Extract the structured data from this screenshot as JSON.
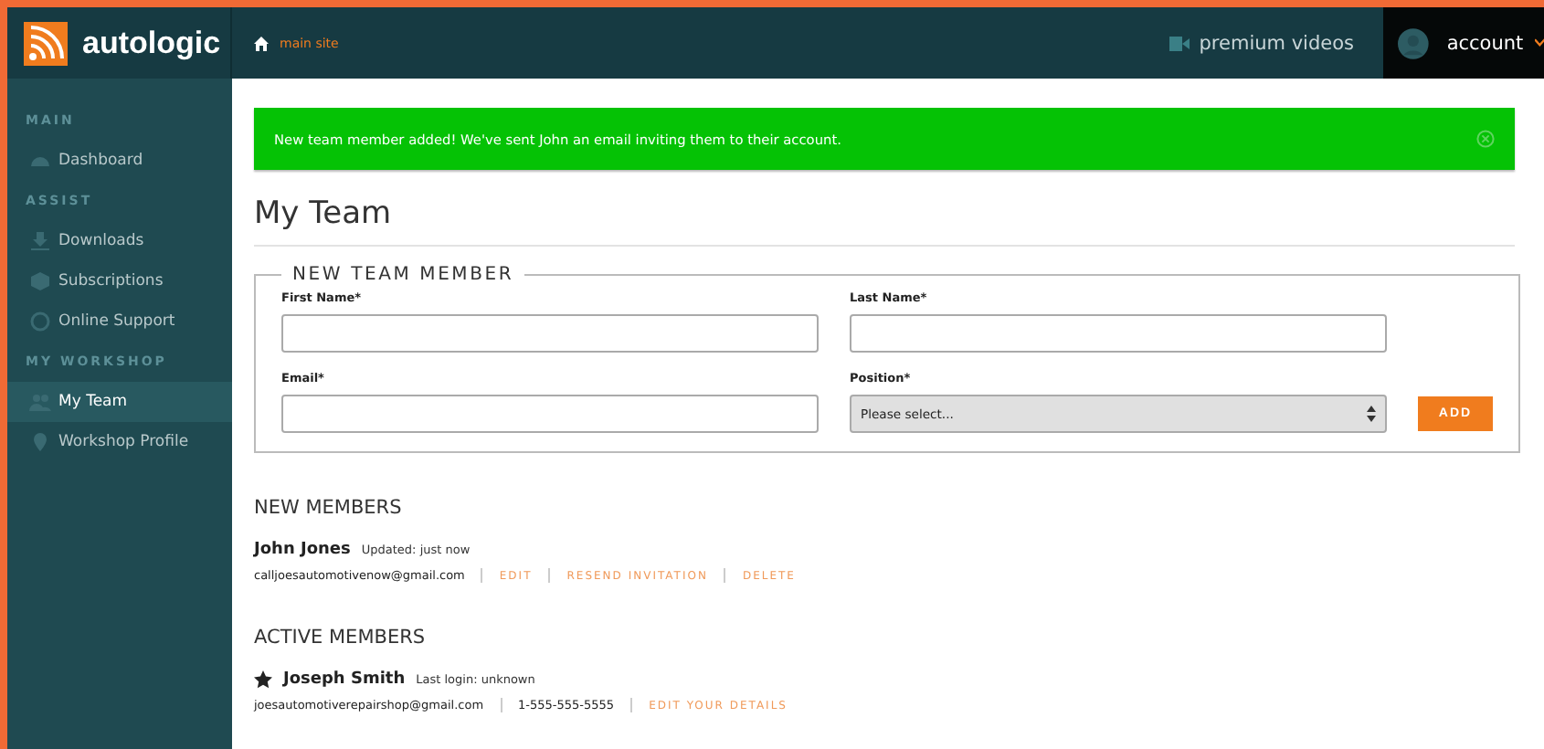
{
  "header": {
    "logo": "autologic",
    "breadcrumb": "main site",
    "premium_link": "premium videos",
    "account": "account"
  },
  "sidebar": {
    "sections": [
      {
        "heading": "MAIN",
        "items": [
          {
            "label": "Dashboard",
            "selected": false
          }
        ]
      },
      {
        "heading": "ASSIST",
        "items": [
          {
            "label": "Downloads",
            "selected": false
          },
          {
            "label": "Subscriptions",
            "selected": false
          },
          {
            "label": "Online Support",
            "selected": false
          }
        ]
      },
      {
        "heading": "MY WORKSHOP",
        "items": [
          {
            "label": "My Team",
            "selected": true
          },
          {
            "label": "Workshop Profile",
            "selected": false
          }
        ]
      }
    ]
  },
  "alert": {
    "message": "New team member added! We've sent John an email inviting them to their account."
  },
  "page_title": "My Team",
  "form": {
    "legend": "NEW TEAM MEMBER",
    "fields": [
      {
        "label": "First Name*",
        "kind": "text"
      },
      {
        "label": "Last Name*",
        "kind": "text"
      },
      {
        "label": "Email*",
        "kind": "text"
      },
      {
        "label": "Position*",
        "kind": "select",
        "value": "Please select..."
      }
    ],
    "submit": "ADD"
  },
  "new_members": {
    "heading": "NEW MEMBERS",
    "members": [
      {
        "name": "John Jones",
        "starred": false,
        "meta": "Updated: just now",
        "details": [
          "calljoesautomotivenow@gmail.com"
        ],
        "actions": [
          "EDIT",
          "RESEND INVITATION",
          "DELETE"
        ]
      }
    ]
  },
  "active_members": {
    "heading": "ACTIVE MEMBERS",
    "members": [
      {
        "name": "Joseph Smith",
        "starred": true,
        "meta": "Last login: unknown",
        "details": [
          "joesautomotiverepairshop@gmail.com",
          "1-555-555-5555"
        ],
        "actions": [
          "EDIT YOUR DETAILS"
        ]
      }
    ]
  }
}
